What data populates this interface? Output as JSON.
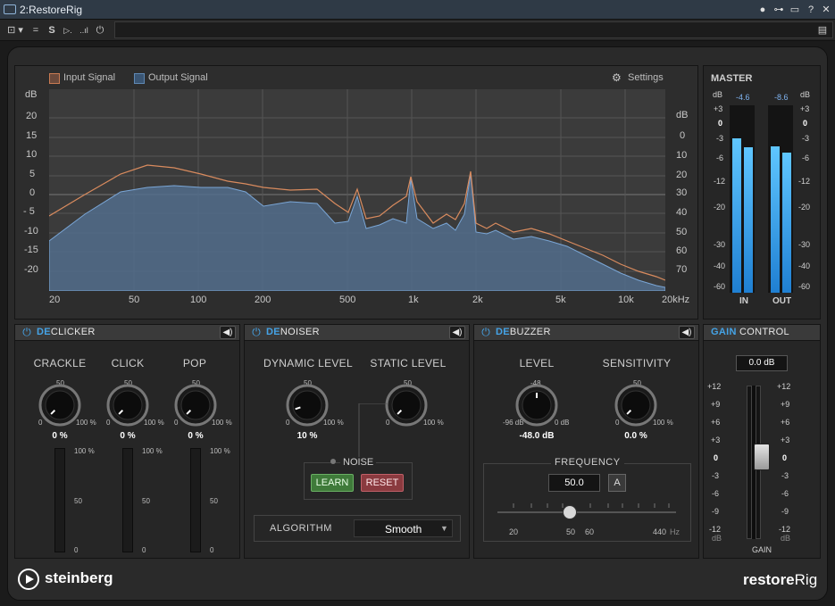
{
  "window": {
    "title": "2:RestoreRig",
    "buttons": [
      "●",
      "⊶",
      "▭",
      "?",
      "✕"
    ]
  },
  "toolbar": {
    "items": [
      "⊡ ▾",
      "=",
      "S",
      "▷.",
      "..ıl",
      "⏻"
    ],
    "right_icon": "▤"
  },
  "spectrum": {
    "legend": [
      {
        "label": "Input Signal",
        "color": "#c97a52"
      },
      {
        "label": "Output Signal",
        "color": "#5f88b3"
      }
    ],
    "settings_label": "Settings",
    "left_unit": "dB",
    "right_unit": "dB",
    "left_ticks": [
      "20",
      "15",
      "10",
      "5",
      "0",
      "- 5",
      "-10",
      "-15",
      "-20"
    ],
    "right_ticks": [
      "0",
      "10",
      "20",
      "30",
      "40",
      "50",
      "60",
      "70"
    ],
    "freq_ticks": [
      "20",
      "50",
      "100",
      "200",
      "500",
      "1k",
      "2k",
      "5k",
      "10k",
      "20kHz"
    ]
  },
  "declicker": {
    "title_prefix": "DE",
    "title_rest": "CLICKER",
    "knobs": [
      {
        "label": "CRACKLE",
        "value": "0 %",
        "min": "0",
        "mid": "50",
        "max": "100 %",
        "level": 0
      },
      {
        "label": "CLICK",
        "value": "0 %",
        "min": "0",
        "mid": "50",
        "max": "100 %",
        "level": 0
      },
      {
        "label": "POP",
        "value": "0 %",
        "min": "0",
        "mid": "50",
        "max": "100 %",
        "level": 0
      }
    ],
    "meter_ticks": [
      "100 %",
      "50",
      "0"
    ]
  },
  "denoiser": {
    "title_prefix": "DE",
    "title_rest": "NOISER",
    "knobs": [
      {
        "label": "DYNAMIC LEVEL",
        "value": "10 %",
        "min": "0",
        "mid": "50",
        "max": "100 %",
        "level": 0.1
      },
      {
        "label": "STATIC LEVEL",
        "value": "",
        "min": "0",
        "mid": "50",
        "max": "100 %",
        "level": 0
      }
    ],
    "noise_label": "NOISE",
    "learn_label": "LEARN",
    "reset_label": "RESET",
    "algorithm_label": "ALGORITHM",
    "algorithm_value": "Smooth"
  },
  "debuzzer": {
    "title_prefix": "DE",
    "title_rest": "BUZZER",
    "knobs": [
      {
        "label": "LEVEL",
        "value": "-48.0 dB",
        "min": "-96 dB",
        "mid": "-48",
        "max": "0 dB",
        "level": 0.5
      },
      {
        "label": "SENSITIVITY",
        "value": "0.0 %",
        "min": "0",
        "mid": "50",
        "max": "100 %",
        "level": 0
      }
    ],
    "frequency_label": "FREQUENCY",
    "frequency_value": "50.0",
    "auto_label": "A",
    "freq_ticks": [
      "20",
      "50",
      "60",
      "440"
    ],
    "freq_unit": "Hz"
  },
  "master": {
    "title": "MASTER",
    "unit_left": "dB",
    "unit_right": "dB",
    "peak_in": "-4.6",
    "peak_out": "-8.6",
    "ticks": [
      "+3",
      "0",
      "-3",
      "-6",
      "-12",
      "-20",
      "-30",
      "-40",
      "-60"
    ],
    "in_label": "IN",
    "out_label": "OUT",
    "levels_db": {
      "in_l": -6.0,
      "in_r": -9.0,
      "out_l": -8.6,
      "out_r": -11.0
    }
  },
  "gain_control": {
    "title_prefix": "GAIN",
    "title_rest": " CONTROL",
    "value": "0.0 dB",
    "ticks": [
      "+12",
      "+9",
      "+6",
      "+3",
      "0",
      "-3",
      "-6",
      "-9",
      "-12"
    ],
    "unit": "dB",
    "footer": "GAIN"
  },
  "footer": {
    "brand": "steinberg",
    "product_bold": "restore",
    "product_rest": "Rig"
  },
  "colors": {
    "accent": "#45a3e6",
    "input_signal": "#c97a52",
    "output_signal": "#5f88b3"
  }
}
